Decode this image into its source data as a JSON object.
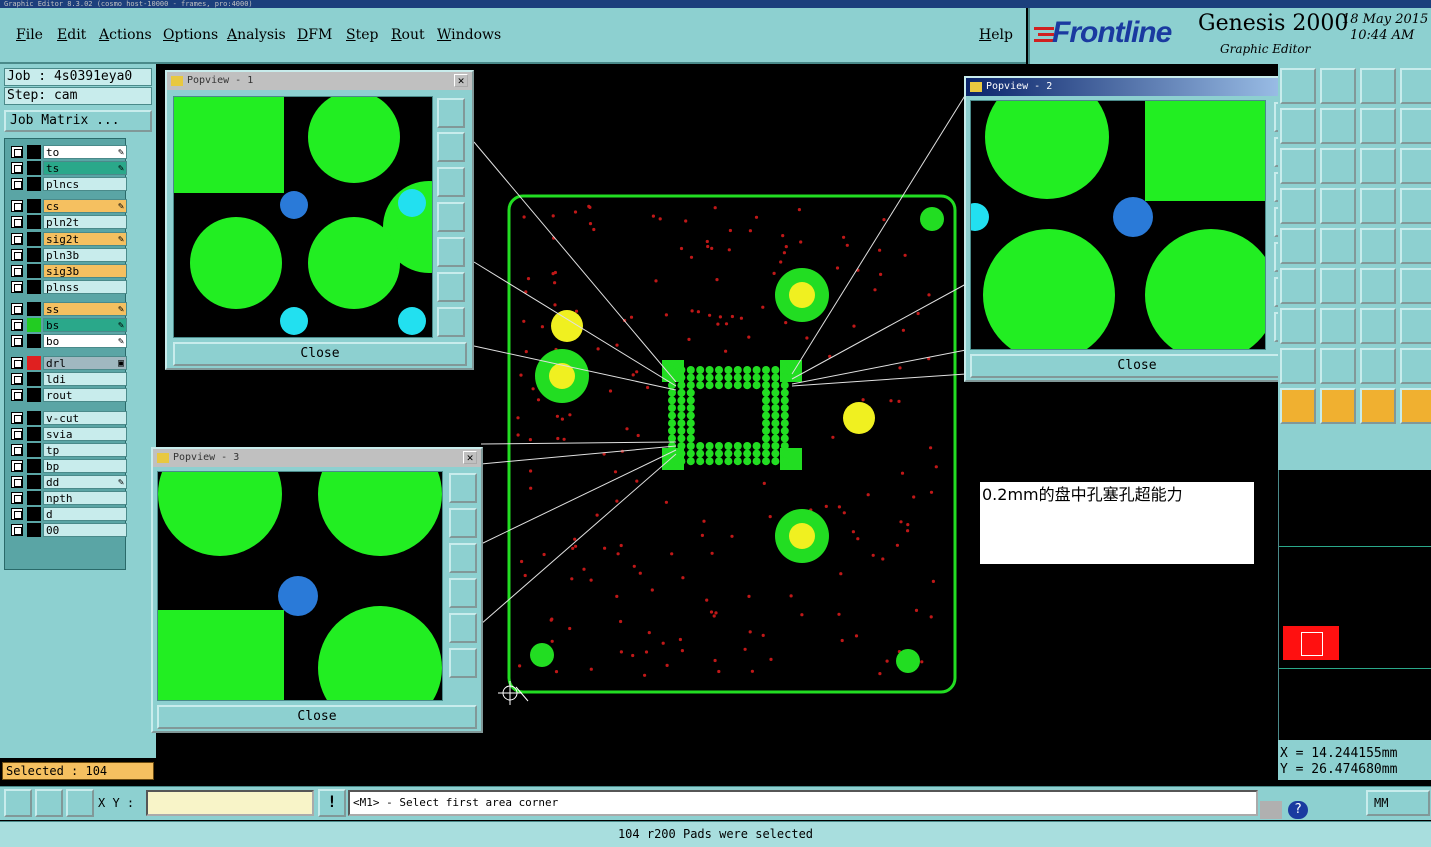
{
  "window": {
    "title": "Graphic Editor 8.3.02 (cosmo host-10000 - frames, pro:4000)"
  },
  "menu": {
    "file": "File",
    "edit": "Edit",
    "actions": "Actions",
    "options": "Options",
    "analysis": "Analysis",
    "dfm": "DFM",
    "step": "Step",
    "rout": "Rout",
    "windows": "Windows",
    "help": "Help"
  },
  "brand": {
    "logo": "Frontline",
    "product": "Genesis 2000",
    "subtitle": "Graphic Editor",
    "date": "18 May 2015",
    "time": "10:44 AM"
  },
  "job": {
    "job_label": "Job : 4s0391eya0",
    "step_label": "Step: cam",
    "matrix_button": "Job Matrix ..."
  },
  "layers": [
    {
      "name": "to",
      "color": "#ffffff",
      "ind": "#000000",
      "mark": "✎"
    },
    {
      "name": "ts",
      "color": "#2aa88a",
      "ind": "#000000",
      "mark": "✎"
    },
    {
      "name": "plncs",
      "color": "#c8ecec",
      "ind": "#000000",
      "mark": ""
    },
    {
      "name": "cs",
      "color": "#f5c060",
      "ind": "#000000",
      "mark": "✎"
    },
    {
      "name": "pln2t",
      "color": "#c8ecec",
      "ind": "#000000",
      "mark": ""
    },
    {
      "name": "sig2t",
      "color": "#f5c060",
      "ind": "#000000",
      "mark": "✎"
    },
    {
      "name": "pln3b",
      "color": "#c8ecec",
      "ind": "#000000",
      "mark": ""
    },
    {
      "name": "sig3b",
      "color": "#f5c060",
      "ind": "#000000",
      "mark": ""
    },
    {
      "name": "plnss",
      "color": "#c8ecec",
      "ind": "#000000",
      "mark": ""
    },
    {
      "name": "ss",
      "color": "#f5c060",
      "ind": "#000000",
      "mark": "✎"
    },
    {
      "name": "bs",
      "color": "#2aa88a",
      "ind": "#22cc22",
      "mark": "✎"
    },
    {
      "name": "bo",
      "color": "#ffffff",
      "ind": "#000000",
      "mark": "✎"
    },
    {
      "name": "drl",
      "color": "#a0b8c0",
      "ind": "#e02020",
      "mark": "▣"
    },
    {
      "name": "ldi",
      "color": "#c8ecec",
      "ind": "#000000",
      "mark": ""
    },
    {
      "name": "rout",
      "color": "#c8ecec",
      "ind": "#000000",
      "mark": ""
    },
    {
      "name": "v-cut",
      "color": "#c8ecec",
      "ind": "#000000",
      "mark": ""
    },
    {
      "name": "svia",
      "color": "#c8ecec",
      "ind": "#000000",
      "mark": ""
    },
    {
      "name": "tp",
      "color": "#c8ecec",
      "ind": "#000000",
      "mark": ""
    },
    {
      "name": "bp",
      "color": "#c8ecec",
      "ind": "#000000",
      "mark": ""
    },
    {
      "name": "dd",
      "color": "#c8ecec",
      "ind": "#000000",
      "mark": "✎"
    },
    {
      "name": "npth",
      "color": "#c8ecec",
      "ind": "#000000",
      "mark": ""
    },
    {
      "name": "d",
      "color": "#c8ecec",
      "ind": "#000000",
      "mark": ""
    },
    {
      "name": "00",
      "color": "#c8ecec",
      "ind": "#000000",
      "mark": ""
    }
  ],
  "selected": "Selected : 104",
  "popups": {
    "p1": {
      "title": "Popview - 1",
      "close": "Close"
    },
    "p2": {
      "title": "Popview - 2",
      "close": "Close"
    },
    "p3": {
      "title": "Popview - 3",
      "close": "Close"
    }
  },
  "note": "0.2mm的盘中孔塞孔超能力",
  "coords": {
    "x": "X  =  14.244155mm",
    "y": "Y  =  26.474680mm"
  },
  "bottom": {
    "xy_label": "X Y :",
    "xy_value": "",
    "prompt": "<M1> - Select first area corner",
    "units": "MM"
  },
  "status": "104 r200 Pads were selected"
}
